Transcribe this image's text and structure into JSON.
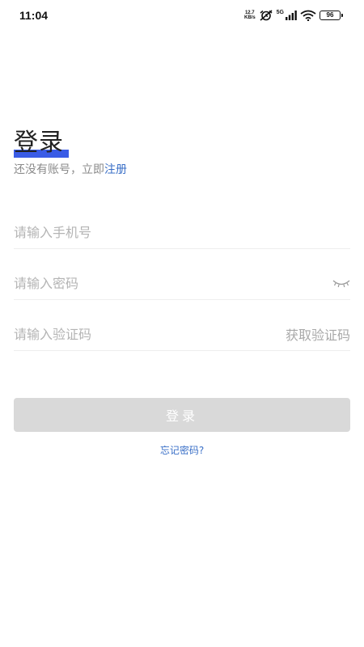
{
  "status_bar": {
    "time": "11:04",
    "net_speed_value": "12.7",
    "net_speed_unit": "KB/s",
    "signal_label": "5G",
    "battery": "96"
  },
  "login": {
    "title": "登录",
    "no_account_text": "还没有账号，立即",
    "register_link": "注册",
    "phone_placeholder": "请输入手机号",
    "password_placeholder": "请输入密码",
    "code_placeholder": "请输入验证码",
    "get_code_label": "获取验证码",
    "login_button_label": "登录",
    "forgot_password_label": "忘记密码?"
  },
  "icons": {
    "password_visibility": "eye-closed-icon"
  },
  "colors": {
    "accent": "#3a6fc7",
    "title_underline": "#3a5ce6",
    "button_disabled": "#d9d9d9"
  }
}
